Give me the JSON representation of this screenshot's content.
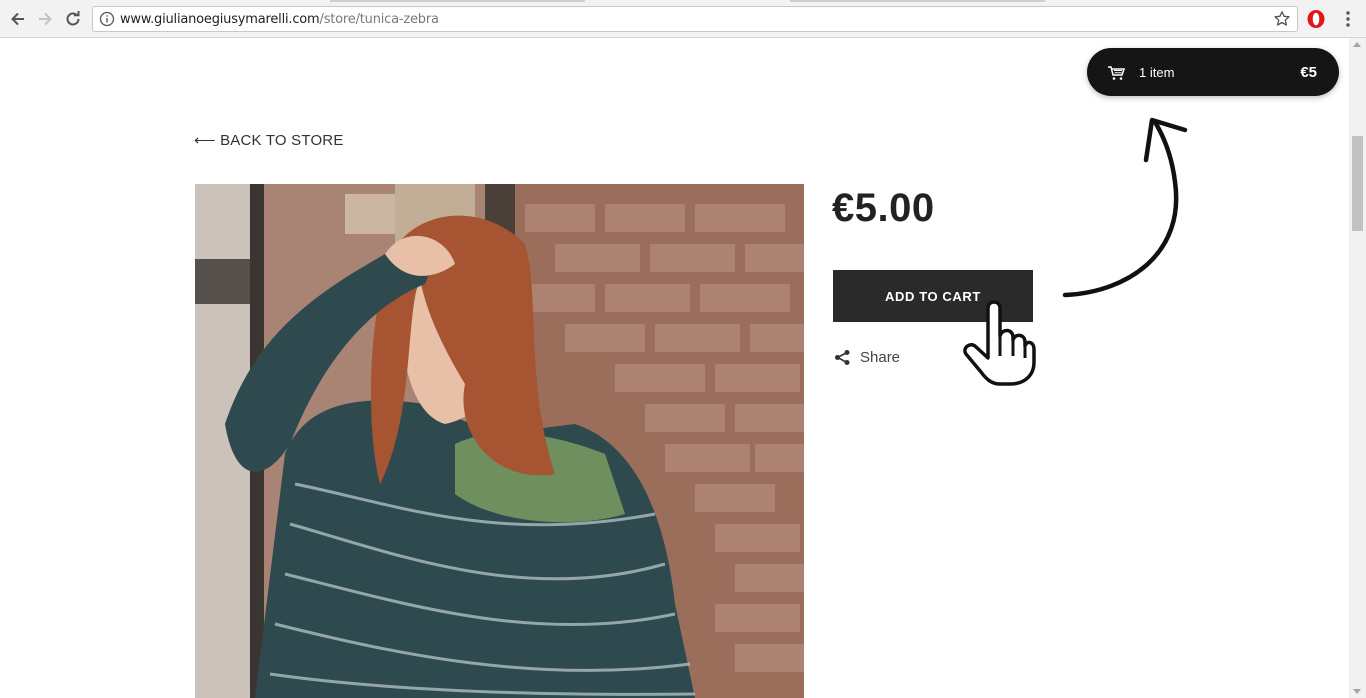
{
  "browser": {
    "url_host": "www.giulianoegiusymarelli.com",
    "url_path": "/store/tunica-zebra",
    "icons": [
      "back-icon",
      "forward-icon",
      "reload-icon",
      "info-icon",
      "star-icon",
      "opera-icon",
      "menu-icon"
    ]
  },
  "page": {
    "back_label": "⟵ BACK TO STORE",
    "price": "€5.00",
    "add_to_cart_label": "ADD TO CART",
    "share_label": "Share"
  },
  "cart": {
    "count_label": "1 item",
    "total": "€5"
  },
  "colors": {
    "button_bg": "#2a2a2a",
    "cart_bg": "#151515",
    "text": "#222222"
  }
}
